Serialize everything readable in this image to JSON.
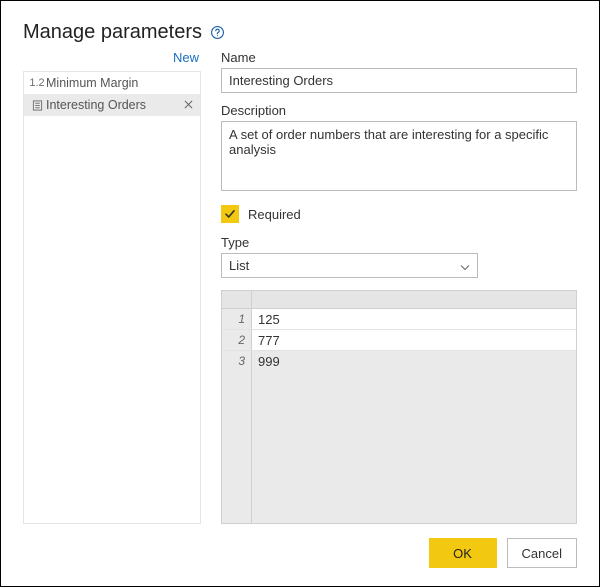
{
  "title": "Manage parameters",
  "new_link": "New",
  "sidebar": {
    "items": [
      {
        "icon": "1.2",
        "label": "Minimum Margin",
        "selected": false
      },
      {
        "icon": "list",
        "label": "Interesting Orders",
        "selected": true
      }
    ]
  },
  "form": {
    "name_label": "Name",
    "name_value": "Interesting Orders",
    "desc_label": "Description",
    "desc_value": "A set of order numbers that are interesting for a specific analysis",
    "required_label": "Required",
    "required_checked": true,
    "type_label": "Type",
    "type_value": "List"
  },
  "chart_data": {
    "type": "table",
    "columns": [
      "value"
    ],
    "rows": [
      {
        "n": 1,
        "value": "125"
      },
      {
        "n": 2,
        "value": "777"
      },
      {
        "n": 3,
        "value": "999"
      }
    ]
  },
  "buttons": {
    "ok": "OK",
    "cancel": "Cancel"
  }
}
